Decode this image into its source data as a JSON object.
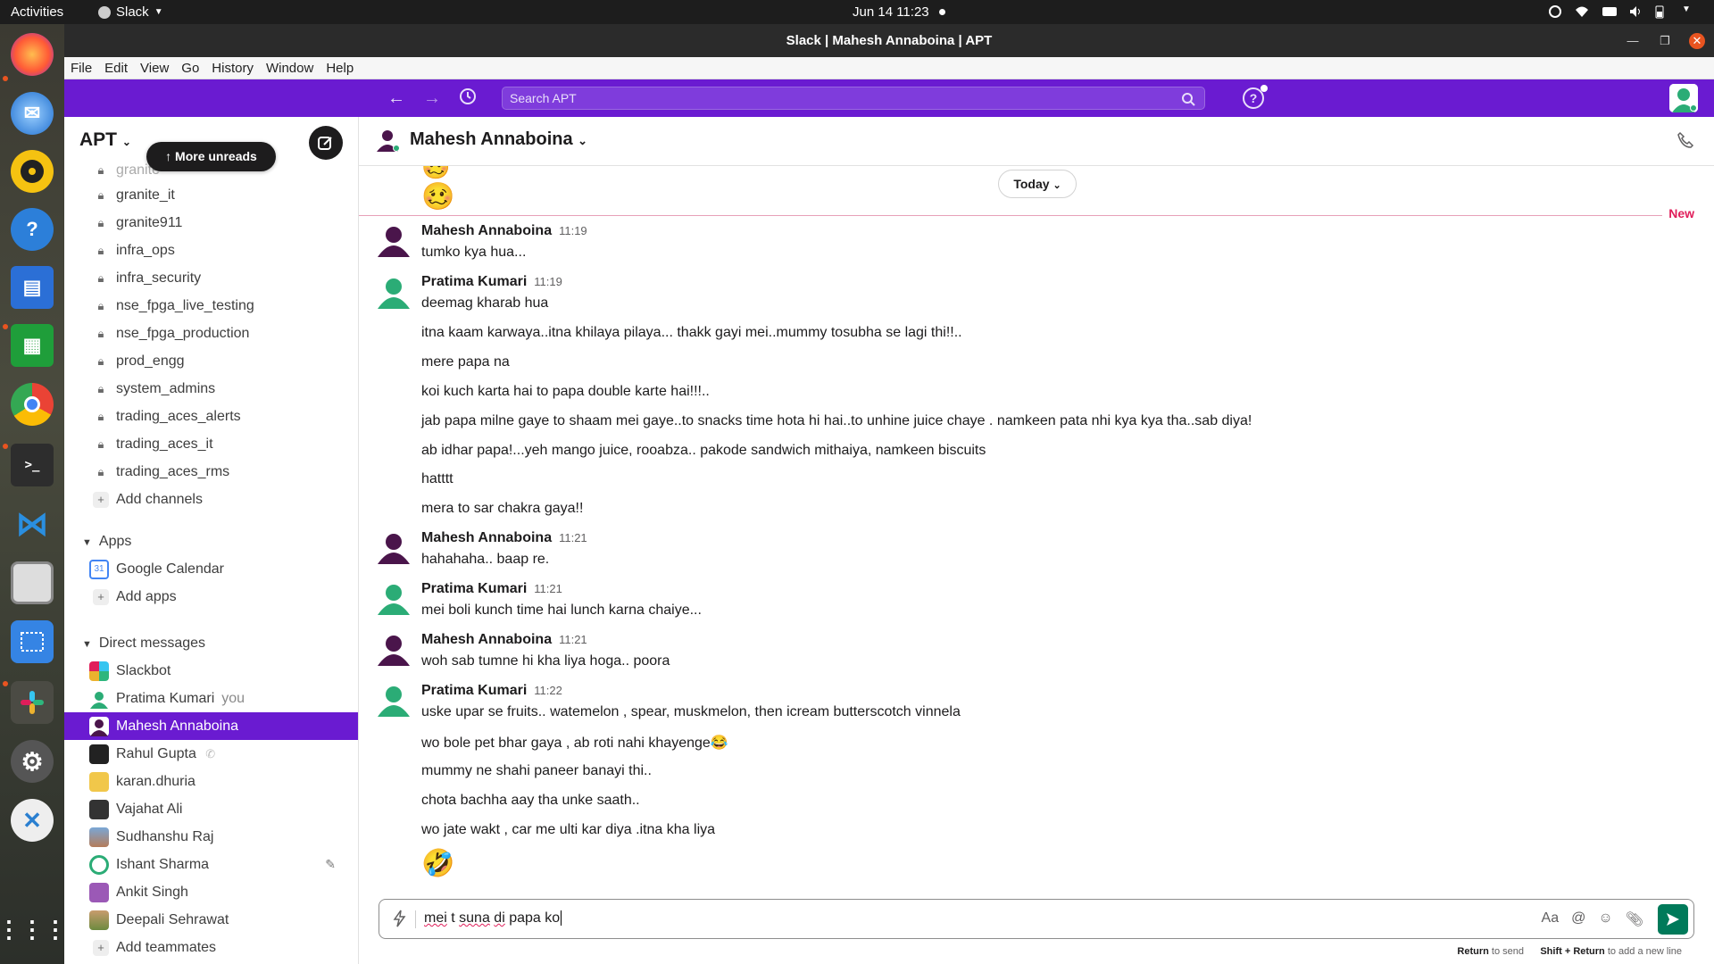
{
  "system": {
    "activities": "Activities",
    "app_name": "Slack",
    "clock": "Jun 14  11:23"
  },
  "window": {
    "title": "Slack | Mahesh Annaboina | APT"
  },
  "menu": [
    "File",
    "Edit",
    "View",
    "Go",
    "History",
    "Window",
    "Help"
  ],
  "header": {
    "search_placeholder": "Search APT"
  },
  "workspace": {
    "name": "APT"
  },
  "sidebar": {
    "more_unreads": "More unreads",
    "channels": [
      {
        "label": "granite"
      },
      {
        "label": "granite_it"
      },
      {
        "label": "granite911"
      },
      {
        "label": "infra_ops"
      },
      {
        "label": "infra_security"
      },
      {
        "label": "nse_fpga_live_testing"
      },
      {
        "label": "nse_fpga_production"
      },
      {
        "label": "prod_engg"
      },
      {
        "label": "system_admins"
      },
      {
        "label": "trading_aces_alerts"
      },
      {
        "label": "trading_aces_it"
      },
      {
        "label": "trading_aces_rms"
      }
    ],
    "add_channels": "Add channels",
    "apps_header": "Apps",
    "apps": [
      {
        "label": "Google Calendar"
      }
    ],
    "add_apps": "Add apps",
    "dm_header": "Direct messages",
    "dms": [
      {
        "label": "Slackbot"
      },
      {
        "label": "Pratima Kumari",
        "suffix": "you"
      },
      {
        "label": "Mahesh Annaboina"
      },
      {
        "label": "Rahul Gupta"
      },
      {
        "label": "karan.dhuria"
      },
      {
        "label": "Vajahat Ali"
      },
      {
        "label": "Sudhanshu Raj"
      },
      {
        "label": "Ishant Sharma"
      },
      {
        "label": "Ankit Singh"
      },
      {
        "label": "Deepali Sehrawat"
      }
    ],
    "add_teammates": "Add teammates"
  },
  "channel": {
    "name": "Mahesh Annaboina",
    "today_label": "Today",
    "new_label": "New"
  },
  "messages": [
    {
      "author": "Mahesh Annaboina",
      "time": "11:19",
      "lines": [
        "tumko kya hua..."
      ]
    },
    {
      "author": "Pratima Kumari",
      "time": "11:19",
      "lines": [
        "deemag kharab hua",
        "itna kaam karwaya..itna khilaya pilaya... thakk gayi mei..mummy tosubha se lagi thi!!..",
        "mere papa na",
        "koi kuch karta hai to papa double karte hai!!!..",
        "jab papa milne gaye to shaam mei gaye..to snacks time hota hi hai..to unhine juice chaye . namkeen pata nhi kya kya tha..sab diya!",
        "ab idhar papa!...yeh mango juice, rooabza.. pakode sandwich mithaiya, namkeen biscuits",
        "hatttt",
        "mera to sar chakra gaya!!"
      ]
    },
    {
      "author": "Mahesh Annaboina",
      "time": "11:21",
      "lines": [
        "hahahaha.. baap re."
      ]
    },
    {
      "author": "Pratima Kumari",
      "time": "11:21",
      "lines": [
        "mei boli kunch time hai lunch karna chaiye..."
      ]
    },
    {
      "author": "Mahesh Annaboina",
      "time": "11:21",
      "lines": [
        "woh sab tumne hi kha liya hoga.. poora"
      ]
    },
    {
      "author": "Pratima Kumari",
      "time": "11:22",
      "lines": [
        "uske upar se fruits.. watemelon , spear, muskmelon, then icream butterscotch vinnela",
        "wo bole pet bhar gaya , ab roti nahi khayenge😂",
        "mummy ne shahi paneer banayi thi..",
        "chota bachha aay tha unke saath..",
        "wo jate wakt , car me ulti kar diya .itna kha liya"
      ]
    }
  ],
  "emojis": {
    "top": "🥴",
    "bottom": "🤣"
  },
  "composer": {
    "text_parts": [
      "mei",
      "t",
      "suna",
      "di",
      "papa",
      "ko"
    ],
    "format_label": "Aa",
    "mention_label": "@"
  },
  "hint": {
    "send_key": "Return",
    "send_text": "to send",
    "newline_key": "Shift + Return",
    "newline_text": "to add a new line"
  },
  "colors": {
    "brand": "#6a1bd1",
    "selected": "#6a1bd1",
    "send": "#007a5a",
    "new": "#e01e5a"
  }
}
